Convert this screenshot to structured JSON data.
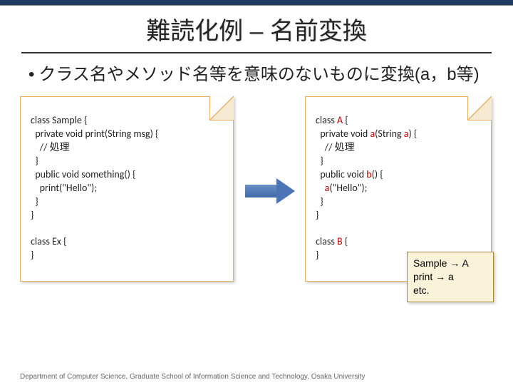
{
  "slide": {
    "title": "難読化例 – 名前変換",
    "bullet": "クラス名やメソッド名等を意味のないものに変換(a，b等)"
  },
  "code_left": {
    "lines": [
      "class Sample {",
      "  private void print(String msg) {",
      "    // 処理",
      "  }",
      "  public void something() {",
      "    print(\"Hello\");",
      "  }",
      "}",
      "",
      "class Ex {",
      "}"
    ]
  },
  "code_right": {
    "tokens": [
      {
        "t": "class ",
        "h": false
      },
      {
        "t": "A",
        "h": true
      },
      {
        "t": " {\n",
        "h": false
      },
      {
        "t": "  private void ",
        "h": false
      },
      {
        "t": "a",
        "h": true
      },
      {
        "t": "(String ",
        "h": false
      },
      {
        "t": "a",
        "h": true
      },
      {
        "t": ") {\n",
        "h": false
      },
      {
        "t": "    // 処理\n",
        "h": false
      },
      {
        "t": "  }\n",
        "h": false
      },
      {
        "t": "  public void ",
        "h": false
      },
      {
        "t": "b",
        "h": true
      },
      {
        "t": "() {\n",
        "h": false
      },
      {
        "t": "    ",
        "h": false
      },
      {
        "t": "a",
        "h": true
      },
      {
        "t": "(\"Hello\");\n",
        "h": false
      },
      {
        "t": "  }\n",
        "h": false
      },
      {
        "t": "}\n",
        "h": false
      },
      {
        "t": "\n",
        "h": false
      },
      {
        "t": "class ",
        "h": false
      },
      {
        "t": "B",
        "h": true
      },
      {
        "t": " {\n",
        "h": false
      },
      {
        "t": "}",
        "h": false
      }
    ]
  },
  "mapping": {
    "line1": "Sample → A",
    "line2": "print → a",
    "line3": "etc."
  },
  "footer": "Department of Computer Science, Graduate School of Information Science and Technology, Osaka University"
}
